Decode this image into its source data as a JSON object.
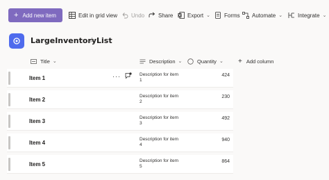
{
  "toolbar": {
    "add_new_item": "Add new item",
    "edit_grid": "Edit in grid view",
    "undo": "Undo",
    "share": "Share",
    "export": "Export",
    "forms": "Forms",
    "automate": "Automate",
    "integrate": "Integrate",
    "accent_color": "#7f6abf"
  },
  "list": {
    "title": "LargeInventoryList",
    "icon": "list-app-icon",
    "icon_color": "#4f6bed"
  },
  "columns": {
    "title": "Title",
    "description": "Description",
    "quantity": "Quantity",
    "add_column": "Add column"
  },
  "rows": [
    {
      "title": "Item 1",
      "desc_line1": "Description for item",
      "desc_line2": "1",
      "quantity": "424"
    },
    {
      "title": "Item 2",
      "desc_line1": "Description for item",
      "desc_line2": "2",
      "quantity": "230"
    },
    {
      "title": "Item 3",
      "desc_line1": "Description for item",
      "desc_line2": "3",
      "quantity": "492"
    },
    {
      "title": "Item 4",
      "desc_line1": "Description for item",
      "desc_line2": "4",
      "quantity": "940"
    },
    {
      "title": "Item 5",
      "desc_line1": "Description for item",
      "desc_line2": "5",
      "quantity": "864"
    }
  ]
}
